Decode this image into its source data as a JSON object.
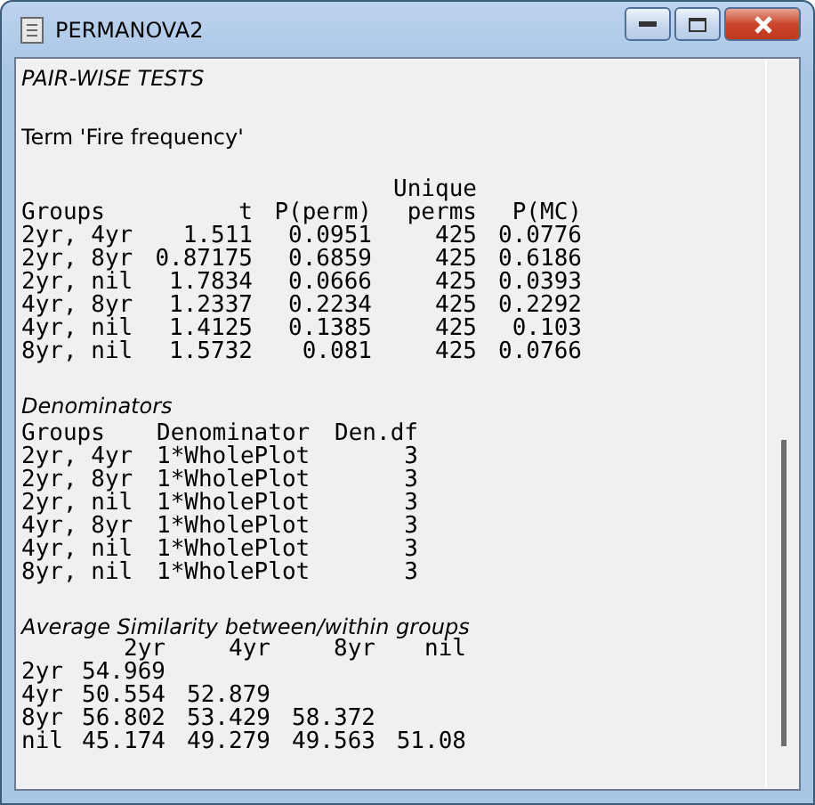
{
  "window": {
    "title": "PERMANOVA2"
  },
  "output": {
    "heading": "PAIR-WISE TESTS",
    "term": "Term 'Fire frequency'",
    "pairwise": {
      "columns": [
        {
          "label": "Groups"
        },
        {
          "label": "t"
        },
        {
          "label": "P(perm)"
        },
        {
          "label": "perms",
          "label_above": "Unique"
        },
        {
          "label": "P(MC)"
        }
      ],
      "rows": [
        [
          "2yr, 4yr",
          "1.511",
          "0.0951",
          "425",
          "0.0776"
        ],
        [
          "2yr, 8yr",
          "0.87175",
          "0.6859",
          "425",
          "0.6186"
        ],
        [
          "2yr, nil",
          "1.7834",
          "0.0666",
          "425",
          "0.0393"
        ],
        [
          "4yr, 8yr",
          "1.2337",
          "0.2234",
          "425",
          "0.2292"
        ],
        [
          "4yr, nil",
          "1.4125",
          "0.1385",
          "425",
          "0.103"
        ],
        [
          "8yr, nil",
          "1.5732",
          "0.081",
          "425",
          "0.0766"
        ]
      ]
    },
    "denominators": {
      "title": "Denominators",
      "columns": [
        "Groups",
        "Denominator",
        "Den.df"
      ],
      "rows": [
        [
          "2yr, 4yr",
          "1*WholePlot",
          "3"
        ],
        [
          "2yr, 8yr",
          "1*WholePlot",
          "3"
        ],
        [
          "2yr, nil",
          "1*WholePlot",
          "3"
        ],
        [
          "4yr, 8yr",
          "1*WholePlot",
          "3"
        ],
        [
          "4yr, nil",
          "1*WholePlot",
          "3"
        ],
        [
          "8yr, nil",
          "1*WholePlot",
          "3"
        ]
      ]
    },
    "similarity": {
      "title": "Average Similarity between/within groups",
      "columns": [
        "2yr",
        "4yr",
        "8yr",
        "nil"
      ],
      "rows": [
        {
          "group": "2yr",
          "values": [
            "54.969"
          ]
        },
        {
          "group": "4yr",
          "values": [
            "50.554",
            "52.879"
          ]
        },
        {
          "group": "8yr",
          "values": [
            "56.802",
            "53.429",
            "58.372"
          ]
        },
        {
          "group": "nil",
          "values": [
            "45.174",
            "49.279",
            "49.563",
            "51.08"
          ]
        }
      ]
    }
  }
}
